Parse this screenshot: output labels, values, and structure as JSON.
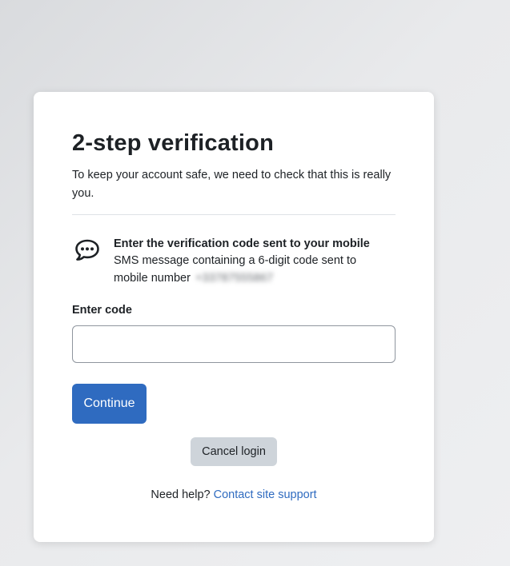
{
  "page": {
    "title": "2-step verification",
    "intro": "To keep your account safe, we need to check that this is really you."
  },
  "sms": {
    "icon": "chat-bubble-icon",
    "heading": "Enter the verification code sent to your mobile",
    "description": "SMS message containing a 6-digit code sent to mobile number",
    "masked_number": "+33787555867"
  },
  "form": {
    "code_label": "Enter code",
    "code_value": "",
    "continue_label": "Continue",
    "cancel_label": "Cancel login"
  },
  "help": {
    "prefix": "Need help?",
    "link_text": "Contact site support"
  },
  "colors": {
    "primary": "#2f6bc0",
    "secondary_button": "#ced4da",
    "text": "#1d2125"
  }
}
